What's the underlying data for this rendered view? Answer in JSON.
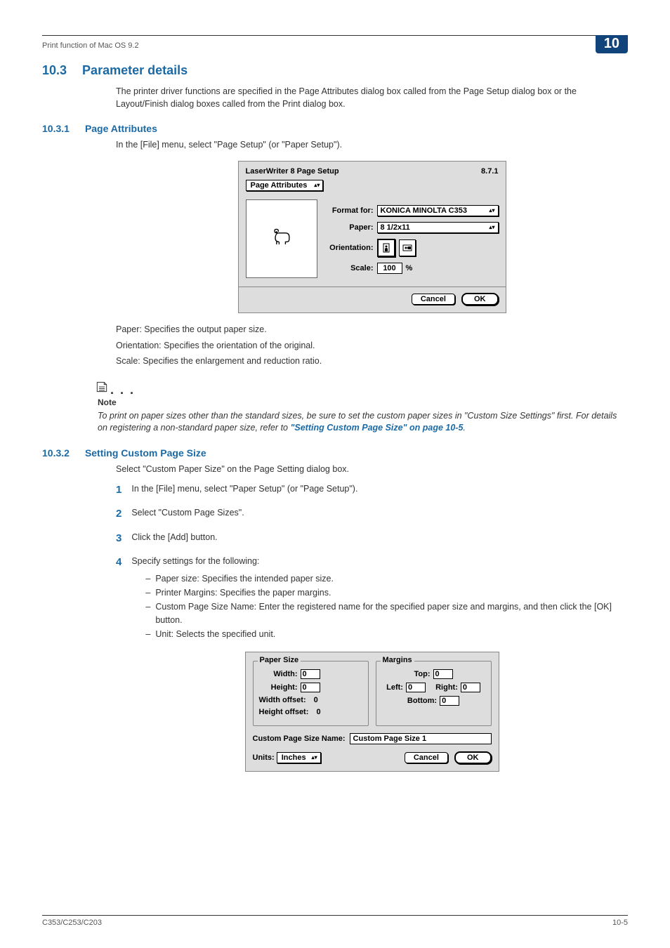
{
  "header": {
    "running_title": "Print function of Mac OS 9.2",
    "chapter_number": "10"
  },
  "h2": {
    "number": "10.3",
    "title": "Parameter details"
  },
  "intro": "The printer driver functions are specified in the Page Attributes dialog box called from the Page Setup dialog box or the Layout/Finish dialog boxes called from the Print dialog box.",
  "sec1": {
    "number": "10.3.1",
    "title": "Page Attributes",
    "lead": "In the [File] menu, select \"Page Setup\" (or \"Paper Setup\").",
    "paper_line": "Paper: Specifies the output paper size.",
    "orient_line": "Orientation: Specifies the orientation of the original.",
    "scale_line": "Scale: Specifies the enlargement and reduction ratio.",
    "note_label": "Note",
    "note_body": "To print on paper sizes other than the standard sizes, be sure to set the custom paper sizes in \"Custom Size Settings\" first. For details on registering a non-standard paper size, refer to ",
    "note_link": "\"Setting Custom Page Size\" on page 10-5",
    "note_tail": "."
  },
  "dialog1": {
    "window_title": "LaserWriter 8 Page Setup",
    "version": "8.7.1",
    "panel_selected": "Page Attributes",
    "format_for_label": "Format for:",
    "format_for_value": "KONICA MINOLTA C353",
    "paper_label": "Paper:",
    "paper_value": "8 1/2x11",
    "orientation_label": "Orientation:",
    "scale_label": "Scale:",
    "scale_value": "100",
    "scale_suffix": "%",
    "cancel": "Cancel",
    "ok": "OK"
  },
  "sec2": {
    "number": "10.3.2",
    "title": "Setting Custom Page Size",
    "lead": "Select \"Custom Paper Size\" on the Page Setting dialog box.",
    "steps": [
      "In the [File] menu, select \"Paper Setup\" (or \"Page Setup\").",
      "Select \"Custom Page Sizes\".",
      "Click the [Add] button.",
      "Specify settings for the following:"
    ],
    "sub": [
      "Paper size: Specifies the intended paper size.",
      "Printer Margins: Specifies the paper margins.",
      "Custom Page Size Name: Enter the registered name for the specified paper size and margins, and then click the [OK] button.",
      "Unit: Selects the specified unit."
    ]
  },
  "dialog2": {
    "papersize_legend": "Paper Size",
    "width_label": "Width:",
    "width_value": "0",
    "height_label": "Height:",
    "height_value": "0",
    "width_off_label": "Width offset:",
    "width_off_value": "0",
    "height_off_label": "Height offset:",
    "height_off_value": "0",
    "margins_legend": "Margins",
    "top_label": "Top:",
    "top_value": "0",
    "left_label": "Left:",
    "left_value": "0",
    "right_label": "Right:",
    "right_value": "0",
    "bottom_label": "Bottom:",
    "bottom_value": "0",
    "name_label": "Custom Page Size Name:",
    "name_value": "Custom Page Size 1",
    "units_label": "Units:",
    "units_value": "Inches",
    "cancel": "Cancel",
    "ok": "OK"
  },
  "footer": {
    "model": "C353/C253/C203",
    "page": "10-5"
  }
}
